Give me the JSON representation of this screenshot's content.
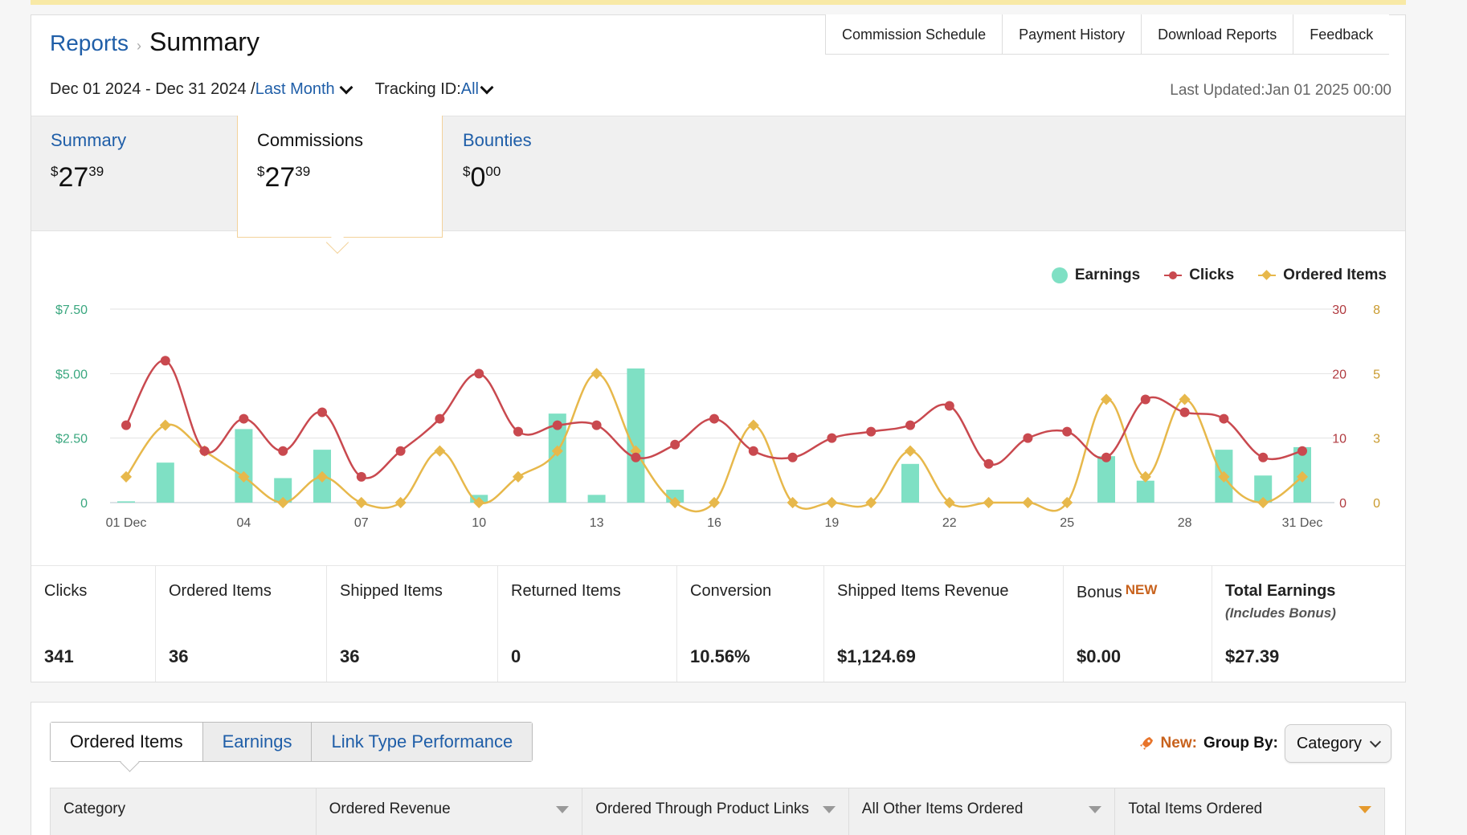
{
  "breadcrumb": {
    "parent": "Reports",
    "current": "Summary"
  },
  "top_links": [
    "Commission Schedule",
    "Payment History",
    "Download Reports",
    "Feedback"
  ],
  "date_range": {
    "range": "Dec 01 2024 - Dec 31 2024 /",
    "preset": "Last Month"
  },
  "tracking": {
    "label": "Tracking ID:",
    "value": "All"
  },
  "last_updated": "Last Updated:Jan 01 2025 00:00",
  "summary_tabs": [
    {
      "label": "Summary",
      "dollar": "$",
      "whole": "27",
      "cents": "39"
    },
    {
      "label": "Commissions",
      "dollar": "$",
      "whole": "27",
      "cents": "39"
    },
    {
      "label": "Bounties",
      "dollar": "$",
      "whole": "0",
      "cents": "00"
    }
  ],
  "legend": {
    "earnings": "Earnings",
    "clicks": "Clicks",
    "ordered": "Ordered Items"
  },
  "colors": {
    "earnings": "#7fe0c4",
    "clicks": "#c9494f",
    "ordered": "#e7b84b",
    "link": "#1f5ea8",
    "accent_new": "#c8621d"
  },
  "chart_data": {
    "type": "bar+line",
    "x": [
      "01 Dec",
      "02",
      "03",
      "04",
      "05",
      "06",
      "07",
      "08",
      "09",
      "10",
      "11",
      "12",
      "13",
      "14",
      "15",
      "16",
      "17",
      "18",
      "19",
      "20",
      "21",
      "22",
      "23",
      "24",
      "25",
      "26",
      "27",
      "28",
      "29",
      "30",
      "31 Dec"
    ],
    "x_tick_labels": [
      "01 Dec",
      "04",
      "07",
      "10",
      "13",
      "16",
      "19",
      "22",
      "25",
      "28",
      "31 Dec"
    ],
    "series": [
      {
        "name": "Earnings",
        "kind": "bar",
        "axis": "left",
        "values": [
          0.05,
          1.55,
          0,
          2.85,
          0.95,
          2.05,
          0,
          0,
          0,
          0.3,
          0,
          3.45,
          0.3,
          5.2,
          0.5,
          0,
          0,
          0,
          0,
          0,
          1.5,
          0,
          0,
          0,
          0,
          1.8,
          0.85,
          0,
          2.05,
          1.05,
          2.15
        ]
      },
      {
        "name": "Clicks",
        "kind": "line",
        "axis": "right1",
        "values": [
          12,
          22,
          8,
          13,
          8,
          14,
          4,
          8,
          13,
          20,
          11,
          12,
          12,
          7,
          9,
          13,
          8,
          7,
          10,
          11,
          12,
          15,
          6,
          10,
          11,
          7,
          16,
          14,
          13,
          7,
          8
        ]
      },
      {
        "name": "Ordered Items",
        "kind": "line",
        "axis": "right2",
        "values": [
          1,
          3,
          2,
          1,
          0,
          1,
          0,
          0,
          2,
          0,
          1,
          2,
          5,
          2,
          0,
          0,
          3,
          0,
          0,
          0,
          2,
          0,
          0,
          0,
          0,
          4,
          1,
          4,
          1,
          0,
          1
        ]
      }
    ],
    "left_axis": {
      "ticks": [
        "$7.50",
        "$5.00",
        "$2.50",
        "0"
      ],
      "range": [
        0,
        7.5
      ]
    },
    "right_axis_1": {
      "ticks": [
        "30",
        "20",
        "10",
        "0"
      ],
      "range": [
        0,
        30
      ]
    },
    "right_axis_2": {
      "ticks": [
        "8",
        "5",
        "3",
        "0"
      ],
      "range": [
        0,
        7.5
      ]
    }
  },
  "stats": [
    {
      "label": "Clicks",
      "value": "341"
    },
    {
      "label": "Ordered Items",
      "value": "36"
    },
    {
      "label": "Shipped Items",
      "value": "36"
    },
    {
      "label": "Returned Items",
      "value": "0"
    },
    {
      "label": "Conversion",
      "value": "10.56%"
    },
    {
      "label": "Shipped Items Revenue",
      "value": "$1,124.69"
    },
    {
      "label": "Bonus",
      "badge": "NEW",
      "value": "$0.00"
    },
    {
      "label": "Total Earnings",
      "sublabel": "(Includes Bonus)",
      "value": "$27.39"
    }
  ],
  "bottom_tabs": [
    "Ordered Items",
    "Earnings",
    "Link Type Performance"
  ],
  "group_by": {
    "new_label": "New:",
    "label": "Group By:",
    "selected": "Category"
  },
  "table_headers": [
    "Category",
    "Ordered Revenue",
    "Ordered Through Product Links",
    "All Other Items Ordered",
    "Total Items Ordered"
  ]
}
